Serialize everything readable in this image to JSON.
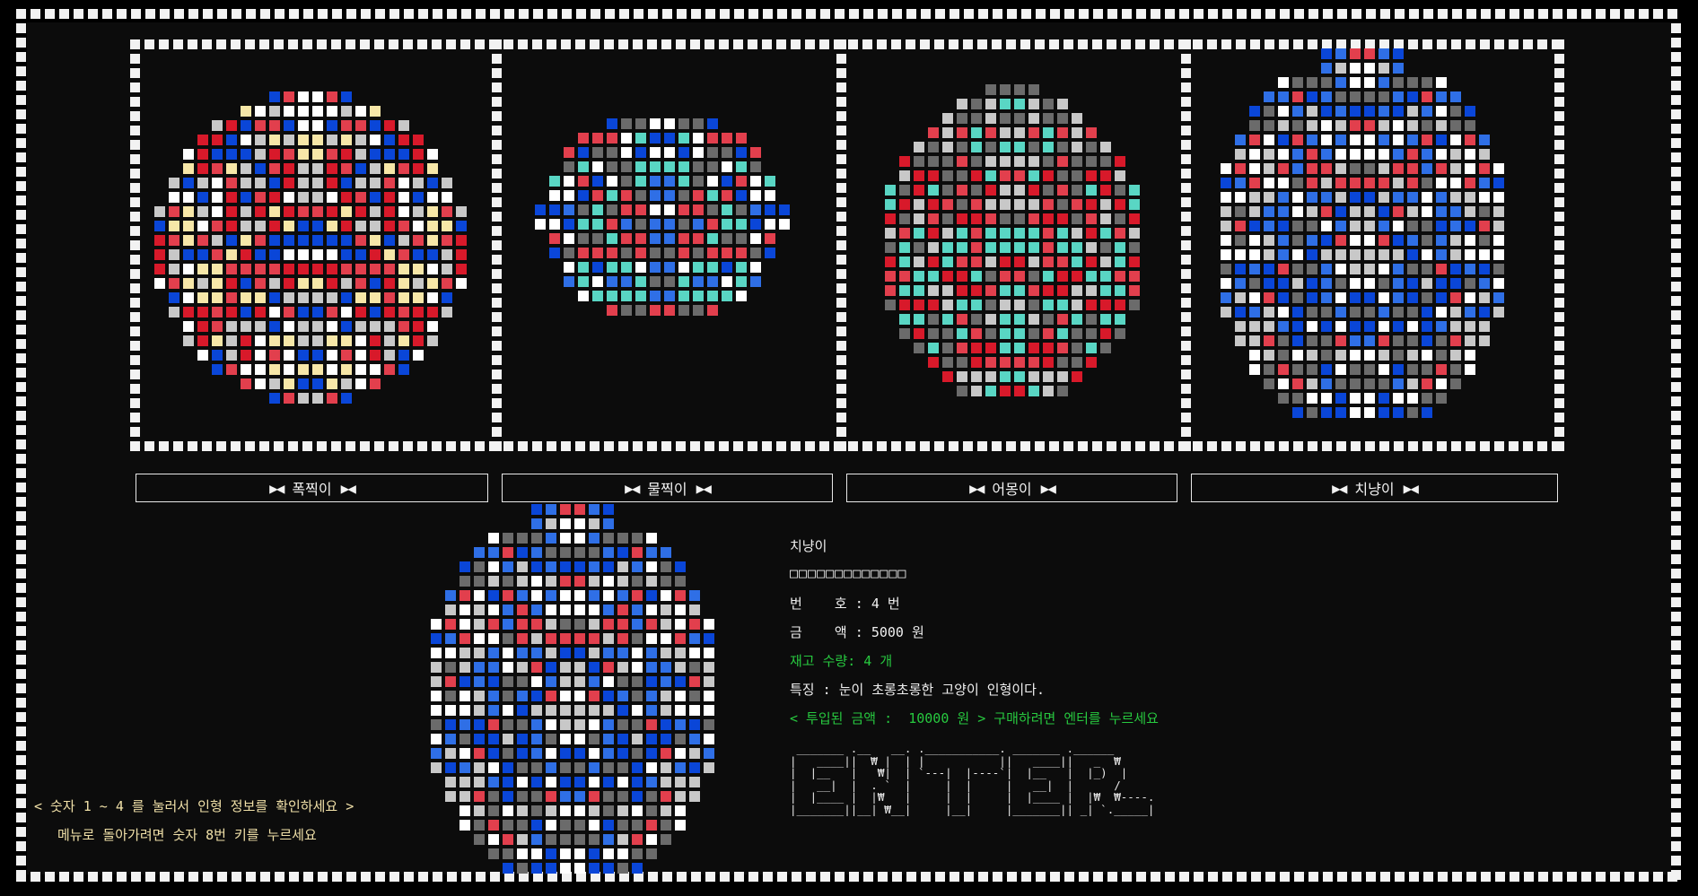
{
  "colors": {
    "background": "#0c0c0c",
    "border": "#f2f2f2",
    "highlight_green": "#27c93f",
    "hint_yellow": "#f0e0a8"
  },
  "dolls": [
    {
      "number": 1,
      "name": "폭찍이",
      "label": "폭찍이",
      "palette": [
        "#f7e7a8",
        "#ffffff",
        "#d8192a",
        "#0a46d8",
        "#c8c8c8",
        "#e23f4d"
      ]
    },
    {
      "number": 2,
      "name": "물찍이",
      "label": "물찍이",
      "palette": [
        "#0a46d8",
        "#2f6fe6",
        "#59d6c4",
        "#e23f4d",
        "#ffffff",
        "#6b6b6b"
      ]
    },
    {
      "number": 3,
      "name": "어몽이",
      "label": "어몽이",
      "palette": [
        "#d8192a",
        "#e23f4d",
        "#59d6c4",
        "#6b6b6b",
        "#c8c8c8"
      ]
    },
    {
      "number": 4,
      "name": "치냥이",
      "label": "치냥이",
      "palette": [
        "#2f6fe6",
        "#0a46d8",
        "#ffffff",
        "#6b6b6b",
        "#e23f4d",
        "#c8c8c8"
      ]
    }
  ],
  "button_decor": "▶◀",
  "selected": {
    "name": "치냥이",
    "separator": "□□□□□□□□□□□□□",
    "number_label": "번    호 : 4 번",
    "price_label": "금    액 : 5000 원",
    "stock_label": "재고 수량: 4 개",
    "feature_label": "특징 : 눈이 초롱초롱한 고양이 인형이다.",
    "deposit_label": "< 투입된 금액 :  10000 원 > 구매하려면 엔터를 누르세요"
  },
  "enter_banner": " _______ .__   __. .___________. _______ .______      \n|   ____||  ₩ |  | |           ||   ____||   _  ₩     \n|  |__   |   ₩|  | `---|  |----`|  |__   |  |_)  |    \n|   __|  |  . `  |     |  |     |   __|  |      /     \n|  |____ |  |₩   |     |  |     |  |____ |  |₩  ₩----.\n|_______||__| ₩__|     |__|     |_______|| _| `._____|",
  "hints": {
    "line1": "< 숫자 1 ~ 4 를 눌러서 인형 정보를 확인하세요 >",
    "line2": "메뉴로 돌아가려면 숫자 8번 키를 누르세요"
  }
}
